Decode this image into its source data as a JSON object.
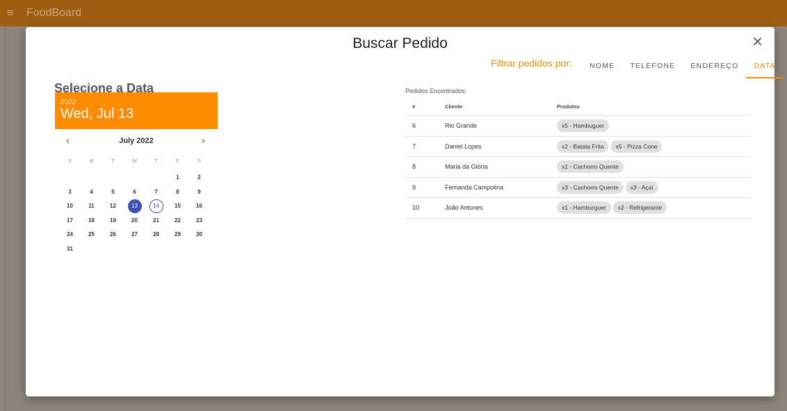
{
  "appbar": {
    "brand": "FoodBoard",
    "menu_icon": "≡"
  },
  "dialog": {
    "title": "Buscar Pedido",
    "close_icon": "✕",
    "filter_label": "Filtrar pedidos por:",
    "tabs": [
      {
        "label": "NOME"
      },
      {
        "label": "TELEFONE"
      },
      {
        "label": "ENDEREÇO"
      },
      {
        "label": "DATA"
      }
    ],
    "active_tab": "DATA"
  },
  "datepicker": {
    "section_title": "Selecione a Data",
    "year": "2022",
    "selected_text": "Wed, Jul 13",
    "month_label": "July 2022",
    "prev_icon": "‹",
    "next_icon": "›",
    "weekdays": [
      "S",
      "M",
      "T",
      "W",
      "T",
      "F",
      "S"
    ],
    "weeks": [
      [
        "",
        "",
        "",
        "",
        "",
        "1",
        "2"
      ],
      [
        "3",
        "4",
        "5",
        "6",
        "7",
        "8",
        "9"
      ],
      [
        "10",
        "11",
        "12",
        "13",
        "14",
        "15",
        "16"
      ],
      [
        "17",
        "18",
        "19",
        "20",
        "21",
        "22",
        "23"
      ],
      [
        "24",
        "25",
        "26",
        "27",
        "28",
        "29",
        "30"
      ],
      [
        "31",
        "",
        "",
        "",
        "",
        "",
        ""
      ]
    ],
    "selected_day": "13",
    "today_day": "14"
  },
  "results": {
    "label": "Pedidos Encontrados:",
    "headers": {
      "num": "#",
      "client": "Cliente",
      "products": "Produtos"
    },
    "rows": [
      {
        "num": "6",
        "client": "Rio Grande",
        "products": [
          "x5 - Hambuguer"
        ]
      },
      {
        "num": "7",
        "client": "Daniel Lopes",
        "products": [
          "x2 - Batata Frita",
          "x5 - Pizza Cone"
        ]
      },
      {
        "num": "8",
        "client": "Maria da Glória",
        "products": [
          "x1 - Cachorro Quente"
        ]
      },
      {
        "num": "9",
        "client": "Fernanda Campolina",
        "products": [
          "x3 - Cachorro Quente",
          "x3 - Açaí"
        ]
      },
      {
        "num": "10",
        "client": "João Antunes",
        "products": [
          "x1 - Hamburguer",
          "x2 - Refrigerante"
        ]
      }
    ]
  },
  "colors": {
    "appbar": "#9e5d10",
    "accent": "#ff8c00",
    "selected_day": "#3f51b5"
  }
}
